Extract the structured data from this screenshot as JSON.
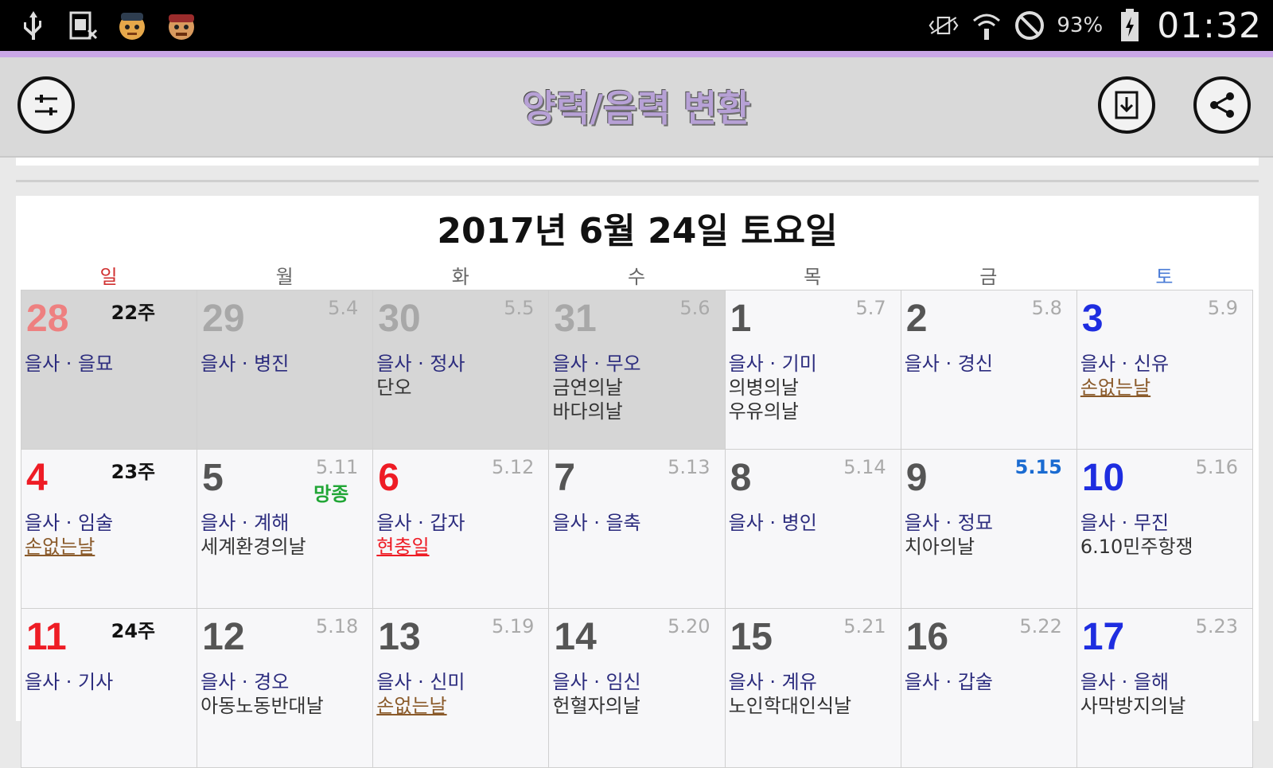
{
  "status_bar": {
    "battery": "93%",
    "time": "01:32"
  },
  "app": {
    "title": "양력/음력 변환"
  },
  "calendar": {
    "heading": "2017년 6월 24일 토요일",
    "weekdays": [
      "일",
      "월",
      "화",
      "수",
      "목",
      "금",
      "토"
    ],
    "weeks": [
      {
        "days": [
          {
            "date": "28",
            "week": "22주",
            "ganji": "을사 · 을묘",
            "notes": [],
            "prev": true,
            "dow": "sun"
          },
          {
            "date": "29",
            "lunar": "5.4",
            "ganji": "을사 · 병진",
            "notes": [],
            "prev": true
          },
          {
            "date": "30",
            "lunar": "5.5",
            "ganji": "을사 · 정사",
            "notes": [
              "단오"
            ],
            "prev": true
          },
          {
            "date": "31",
            "lunar": "5.6",
            "ganji": "을사 · 무오",
            "notes": [
              "금연의날",
              "바다의날"
            ],
            "prev": true
          },
          {
            "date": "1",
            "lunar": "5.7",
            "ganji": "을사 · 기미",
            "notes": [
              "의병의날",
              "우유의날"
            ]
          },
          {
            "date": "2",
            "lunar": "5.8",
            "ganji": "을사 · 경신",
            "notes": []
          },
          {
            "date": "3",
            "lunar": "5.9",
            "ganji": "을사 · 신유",
            "notes": [
              "손없는날"
            ],
            "note_style": "brown",
            "dow": "sat"
          }
        ]
      },
      {
        "days": [
          {
            "date": "4",
            "week": "23주",
            "ganji": "을사 · 임술",
            "notes": [
              "손없는날"
            ],
            "note_style": "brown",
            "dow": "sun"
          },
          {
            "date": "5",
            "lunar": "5.11",
            "moon": "망종",
            "ganji": "을사 · 계해",
            "notes": [
              "세계환경의날"
            ]
          },
          {
            "date": "6",
            "lunar": "5.12",
            "ganji": "을사 · 갑자",
            "notes": [
              "현충일"
            ],
            "note_style": "red",
            "holiday": true
          },
          {
            "date": "7",
            "lunar": "5.13",
            "ganji": "을사 · 을축",
            "notes": []
          },
          {
            "date": "8",
            "lunar": "5.14",
            "ganji": "을사 · 병인",
            "notes": []
          },
          {
            "date": "9",
            "lunar": "5.15",
            "lunar_style": "blue",
            "ganji": "을사 · 정묘",
            "notes": [
              "치아의날"
            ]
          },
          {
            "date": "10",
            "lunar": "5.16",
            "ganji": "을사 · 무진",
            "notes": [
              "6.10민주항쟁"
            ],
            "dow": "sat"
          }
        ]
      },
      {
        "days": [
          {
            "date": "11",
            "week": "24주",
            "ganji": "을사 · 기사",
            "notes": [],
            "dow": "sun"
          },
          {
            "date": "12",
            "lunar": "5.18",
            "ganji": "을사 · 경오",
            "notes": [
              "아동노동반대날"
            ]
          },
          {
            "date": "13",
            "lunar": "5.19",
            "ganji": "을사 · 신미",
            "notes": [
              "손없는날"
            ],
            "note_style": "brown"
          },
          {
            "date": "14",
            "lunar": "5.20",
            "ganji": "을사 · 임신",
            "notes": [
              "헌혈자의날"
            ]
          },
          {
            "date": "15",
            "lunar": "5.21",
            "ganji": "을사 · 계유",
            "notes": [
              "노인학대인식날"
            ]
          },
          {
            "date": "16",
            "lunar": "5.22",
            "ganji": "을사 · 갑술",
            "notes": []
          },
          {
            "date": "17",
            "lunar": "5.23",
            "ganji": "을사 · 을해",
            "notes": [
              "사막방지의날"
            ],
            "dow": "sat"
          }
        ]
      }
    ]
  },
  "colors": {
    "accent_line": "#c9a7e6",
    "toolbar_bg": "#d9d9d9",
    "title_color": "#b7a1d6",
    "sunday_red": "#ee1c25",
    "saturday_blue": "#1e2de0",
    "ganji_navy": "#2c2c7e"
  }
}
